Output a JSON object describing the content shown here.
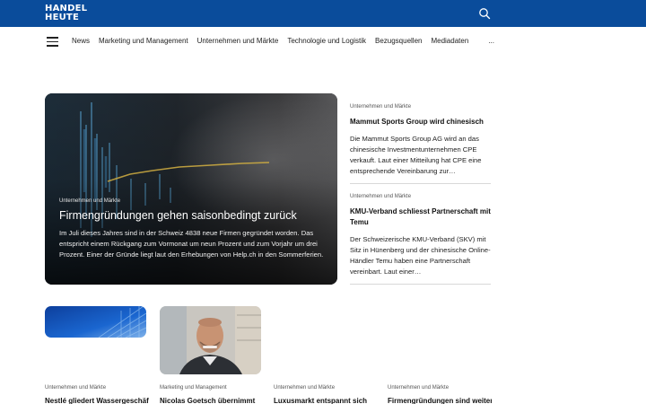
{
  "header": {
    "logo_line1": "HANDEL",
    "logo_line2": "HEUTE",
    "brand_color": "#0a4c9b"
  },
  "nav": {
    "items": [
      "News",
      "Marketing und Management",
      "Unternehmen und Märkte",
      "Technologie und Logistik",
      "Bezugsquellen",
      "Mediadaten"
    ],
    "more": "..."
  },
  "hero": {
    "category": "Unternehmen und Märkte",
    "title": "Firmengründungen gehen saisonbedingt zurück",
    "teaser": "Im Juli dieses Jahres sind in der Schweiz 4838 neue Firmen gegründet worden. Das entspricht einem Rückgang zum Vormonat um neun Prozent und zum Vorjahr um drei Prozent. Einer der Gründe liegt laut den Erhebungen von Help.ch in den Sommerferien."
  },
  "side_articles": [
    {
      "category": "Unternehmen und Märkte",
      "title": "Mammut Sports Group wird chinesisch",
      "teaser": "Die Mammut Sports Group AG wird an das chinesische Investmentunternehmen CPE verkauft. Laut einer Mitteilung hat CPE eine entsprechende Vereinbarung zur…"
    },
    {
      "category": "Unternehmen und Märkte",
      "title": "KMU-Verband schliesst Partnerschaft mit Temu",
      "teaser": "Der Schweizerische KMU-Verband (SKV) mit Sitz in Hünenberg und der chinesische Online-Händler Temu haben eine Partnerschaft vereinbart. Laut einer…"
    }
  ],
  "cards": [
    {
      "category": "Unternehmen und Märkte",
      "title": "Nestlé gliedert Wassergeschäft"
    },
    {
      "category": "Marketing und Management",
      "title": "Nicolas Goetsch übernimmt"
    },
    {
      "category": "Unternehmen und Märkte",
      "title": "Luxusmarkt entspannt sich"
    },
    {
      "category": "Unternehmen und Märkte",
      "title": "Firmengründungen sind weiter"
    }
  ]
}
